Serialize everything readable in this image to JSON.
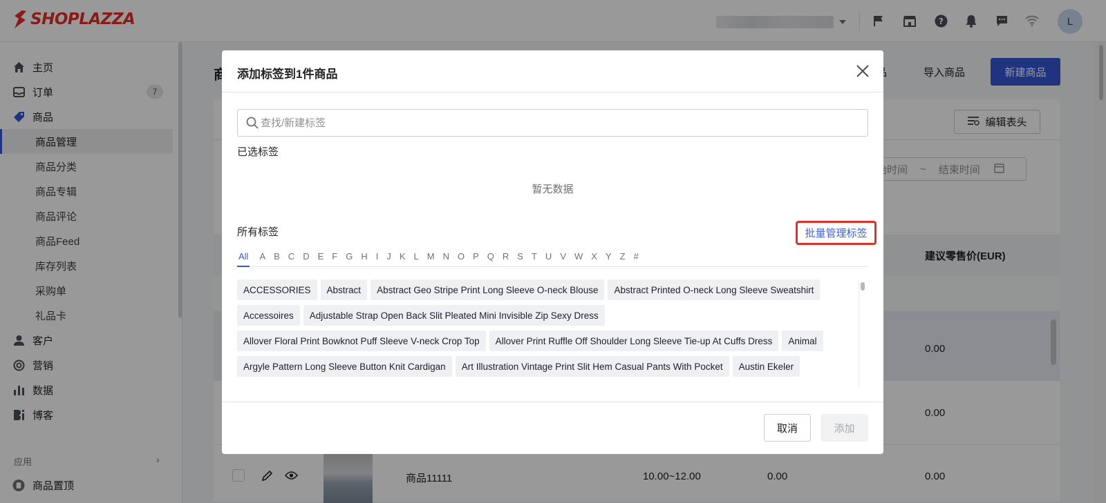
{
  "brand": {
    "name": "SHOPLAZZA",
    "color": "#e5302a"
  },
  "topbar": {
    "icons": [
      "flag-icon",
      "store-icon",
      "help-icon",
      "bell-icon",
      "chat-icon",
      "wifi-icon"
    ],
    "avatar_initial": "L"
  },
  "sidebar": {
    "items": [
      {
        "label": "主页",
        "icon": "home-icon"
      },
      {
        "label": "订单",
        "icon": "inbox-icon",
        "badge": "7"
      },
      {
        "label": "商品",
        "icon": "tag-icon"
      },
      {
        "label": "客户",
        "icon": "person-icon"
      },
      {
        "label": "营销",
        "icon": "target-icon"
      },
      {
        "label": "数据",
        "icon": "bar-chart-icon"
      },
      {
        "label": "博客",
        "icon": "blog-icon"
      }
    ],
    "sub_items": [
      "商品管理",
      "商品分类",
      "商品专辑",
      "商品评论",
      "商品Feed",
      "库存列表",
      "采购单",
      "礼品卡"
    ],
    "section_label": "应用",
    "app_item": "商品置顶"
  },
  "page": {
    "title": "商",
    "header_link_1": "品",
    "header_link_2": "导入商品",
    "new_button": "新建商品",
    "edit_header_button": "编辑表头",
    "date_start": "开始时间",
    "date_sep": "~",
    "date_end": "结束时间",
    "table_header_price": "建议零售价(EUR)",
    "rows": [
      {
        "name": "",
        "price_range": "",
        "cost": "",
        "retail": "0.00"
      },
      {
        "name": "",
        "price_range": "",
        "cost": "",
        "retail": "0.00"
      },
      {
        "name": "商品11111",
        "price_range": "10.00~12.00",
        "cost": "0.00",
        "retail": "0.00"
      }
    ]
  },
  "modal": {
    "title": "添加标签到1件商品",
    "search_placeholder": "查找/新建标签",
    "selected_label": "已选标签",
    "empty_text": "暂无数据",
    "all_label": "所有标签",
    "bulk_manage": "批量管理标签",
    "letters": [
      "All",
      "A",
      "B",
      "C",
      "D",
      "E",
      "F",
      "G",
      "H",
      "I",
      "J",
      "K",
      "L",
      "M",
      "N",
      "O",
      "P",
      "Q",
      "R",
      "S",
      "T",
      "U",
      "V",
      "W",
      "X",
      "Y",
      "Z",
      "#"
    ],
    "tags": [
      "ACCESSORIES",
      "Abstract",
      "Abstract Geo Stripe Print Long Sleeve O-neck Blouse",
      "Abstract Printed O-neck Long Sleeve Sweatshirt",
      "Accessoires",
      "Adjustable Strap Open Back Slit Pleated Mini Invisible Zip Sexy Dress",
      "Allover Floral Print Bowknot Puff Sleeve V-neck Crop Top",
      "Allover Print Ruffle Off Shoulder Long Sleeve Tie-up At Cuffs Dress",
      "Animal",
      "Argyle Pattern Long Sleeve Button Knit Cardigan",
      "Art Illustration Vintage Print Slit Hem Casual Pants With Pocket",
      "Austin Ekeler"
    ],
    "cancel": "取消",
    "add": "添加"
  },
  "colors": {
    "accent": "#3655d4",
    "highlight_box": "#e0302a",
    "link": "#3e62e0"
  }
}
